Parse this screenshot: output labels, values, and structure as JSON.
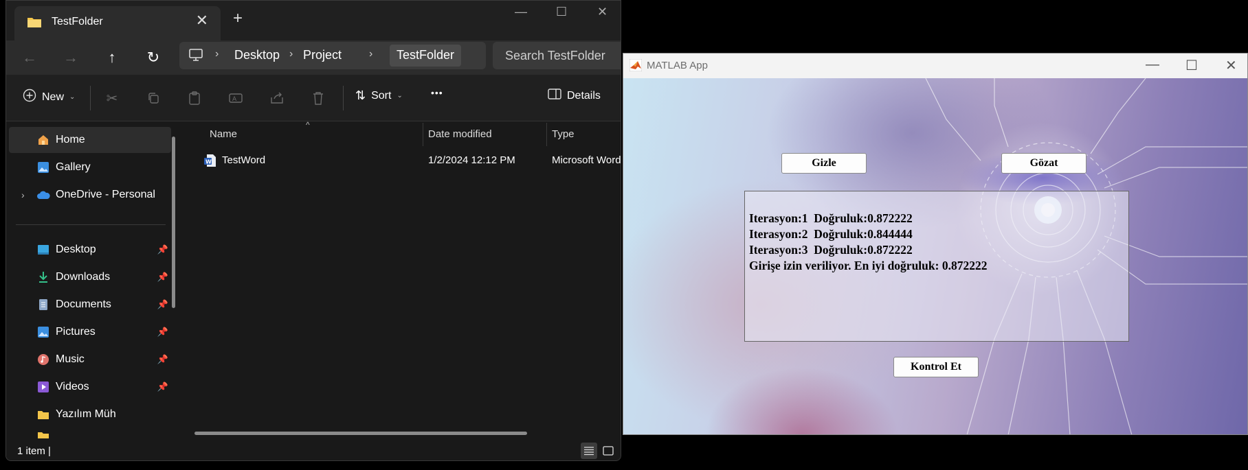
{
  "explorer": {
    "tab_title": "TestFolder",
    "tab_close": "✕",
    "new_tab": "+",
    "window": {
      "minimize": "—",
      "maximize": "☐",
      "close": "✕"
    },
    "nav": {
      "back": "←",
      "forward": "→",
      "up": "↑",
      "refresh": "↻"
    },
    "breadcrumb": [
      "Desktop",
      "Project",
      "TestFolder"
    ],
    "breadcrumb_sep": "›",
    "search_placeholder": "Search TestFolder",
    "toolbar": {
      "new_label": "New",
      "sort_label": "Sort",
      "more_label": "•••",
      "details_label": "Details"
    },
    "sidebar": {
      "items": [
        {
          "label": "Home",
          "icon": "home-icon"
        },
        {
          "label": "Gallery",
          "icon": "gallery-icon"
        },
        {
          "label": "OneDrive - Personal",
          "icon": "cloud-icon"
        },
        {
          "label": "Desktop",
          "icon": "desktop-icon"
        },
        {
          "label": "Downloads",
          "icon": "download-icon"
        },
        {
          "label": "Documents",
          "icon": "documents-icon"
        },
        {
          "label": "Pictures",
          "icon": "pictures-icon"
        },
        {
          "label": "Music",
          "icon": "music-icon"
        },
        {
          "label": "Videos",
          "icon": "videos-icon"
        },
        {
          "label": "Yazılım Müh",
          "icon": "folder-icon"
        }
      ]
    },
    "columns": {
      "name": "Name",
      "date": "Date modified",
      "type": "Type"
    },
    "files": [
      {
        "name": "TestWord",
        "date": "1/2/2024 12:12 PM",
        "type": "Microsoft Word Document",
        "icon": "word-doc-icon"
      }
    ],
    "status_text": "1 item  |",
    "colors": {
      "bg": "#191919",
      "accent_folder": "#f3c54a",
      "onedrive": "#3a8ee6"
    }
  },
  "matlab": {
    "title": "MATLAB App",
    "window": {
      "minimize": "—",
      "maximize": "☐",
      "close": "✕"
    },
    "buttons": {
      "hide": "Gizle",
      "browse": "Gözat",
      "check": "Kontrol Et"
    },
    "output_lines": [
      "Iterasyon:1  Doğruluk:0.872222",
      "Iterasyon:2  Doğruluk:0.844444",
      "Iterasyon:3  Doğruluk:0.872222",
      "Girişe izin veriliyor. En iyi doğruluk: 0.872222"
    ]
  }
}
